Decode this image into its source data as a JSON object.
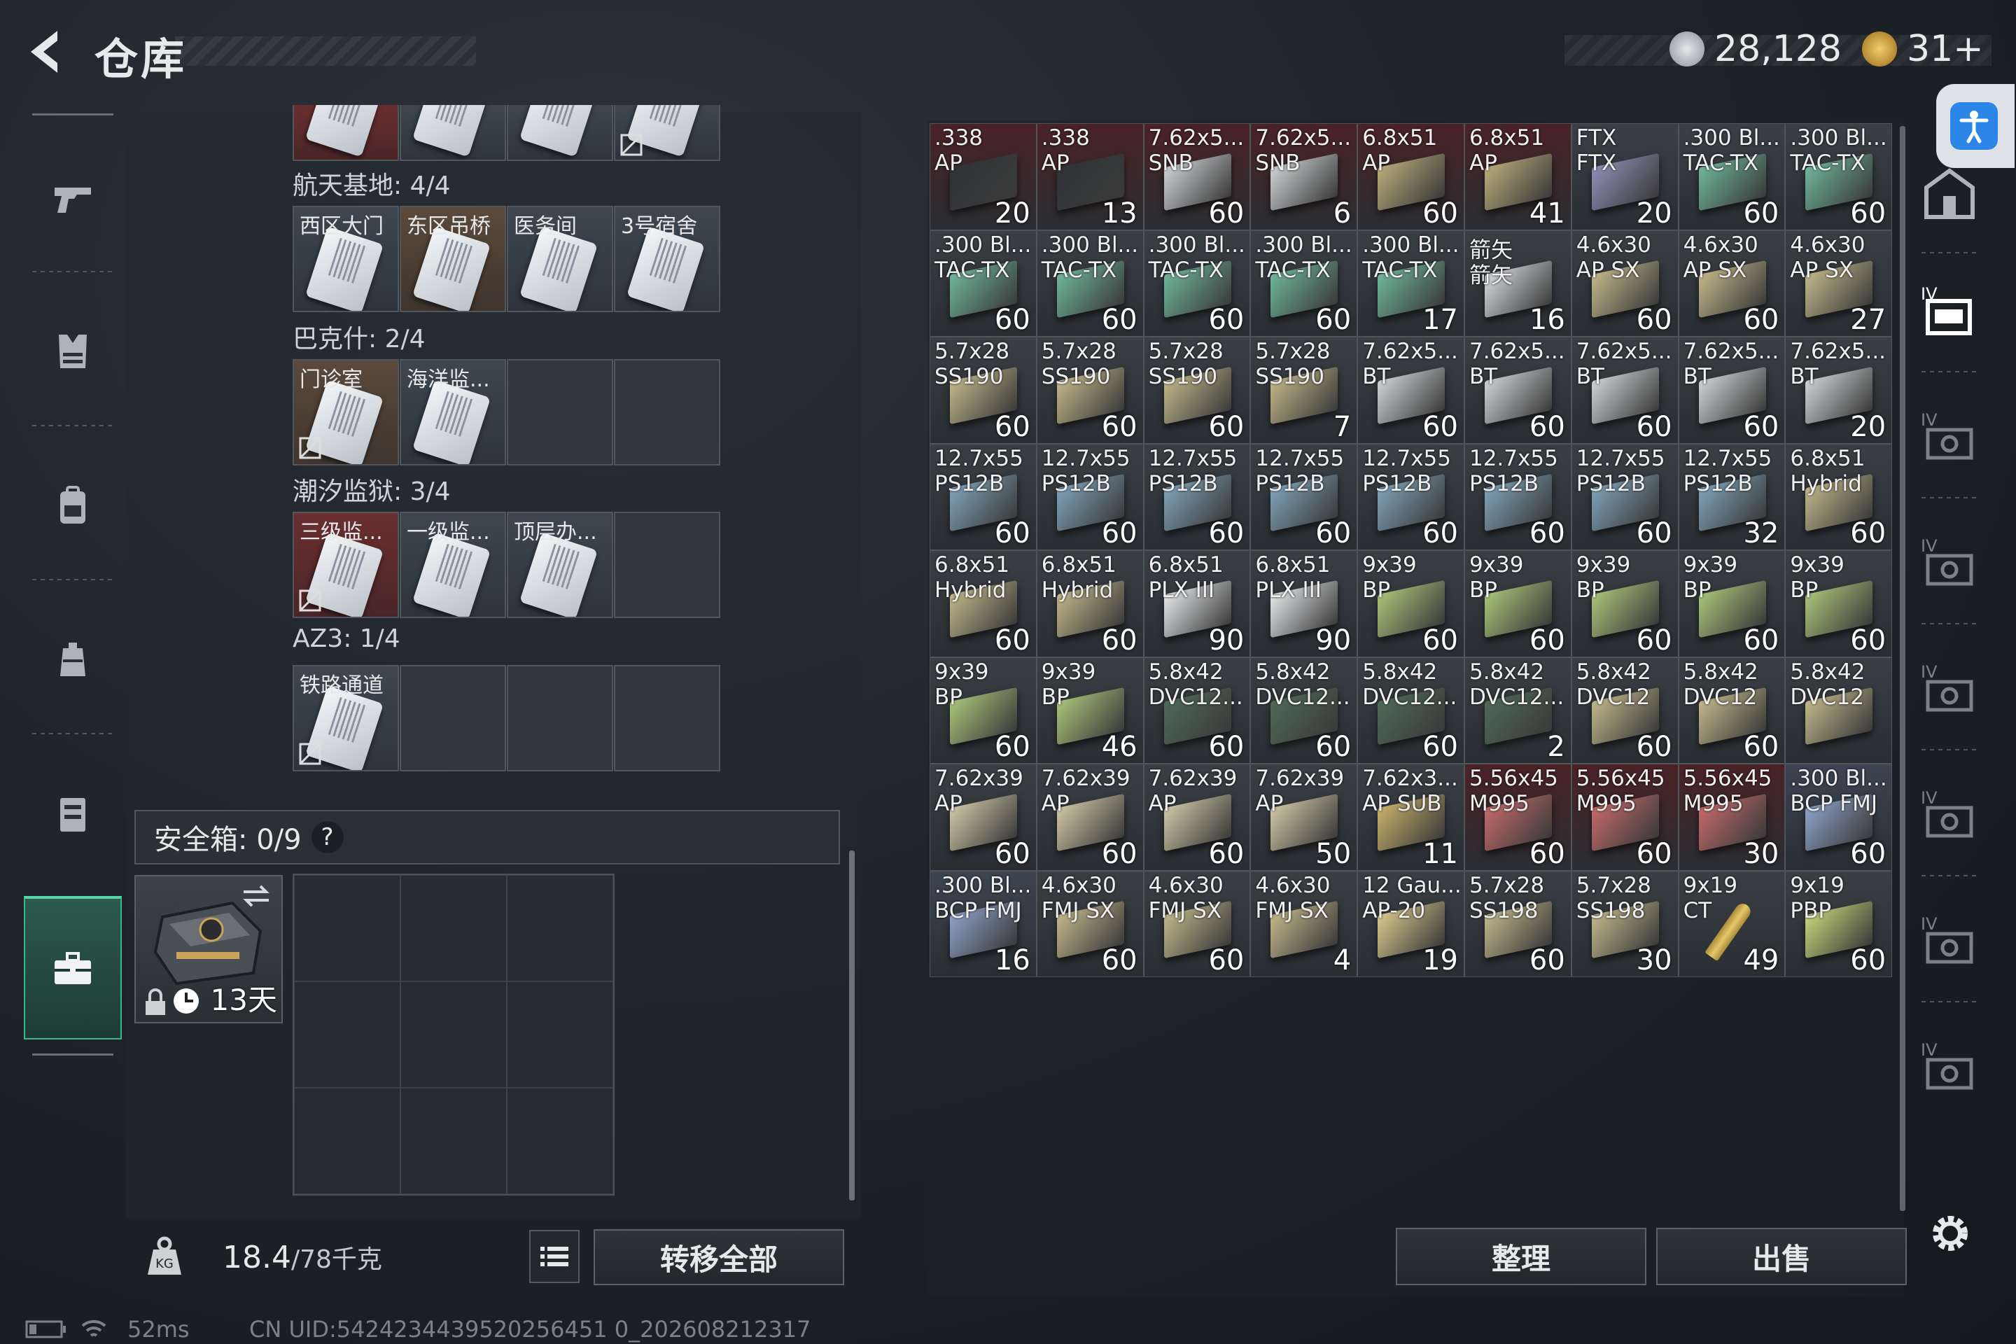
{
  "header": {
    "title": "仓库",
    "currency1": "28,128",
    "currency2": "31+",
    "colors": {
      "silver": "#c8ccd0",
      "gold": "#d9a93c"
    }
  },
  "nav": {
    "items": [
      "pistol-icon",
      "vest-icon",
      "backpack-icon",
      "rig-icon",
      "container-icon",
      "case-icon"
    ],
    "active_index": 5
  },
  "keycards": {
    "groups": [
      {
        "label": "航天基地: 4/4",
        "slots": [
          {
            "name": "西区大门",
            "color": "slate"
          },
          {
            "name": "东区吊桥",
            "color": "brown"
          },
          {
            "name": "医务间",
            "color": "slate"
          },
          {
            "name": "3号宿舍",
            "color": "slate"
          }
        ]
      },
      {
        "label": "巴克什: 2/4",
        "slots": [
          {
            "name": "门诊室",
            "color": "brown",
            "locked": true
          },
          {
            "name": "海洋监...",
            "color": "slate"
          },
          {
            "name": "",
            "color": ""
          },
          {
            "name": "",
            "color": ""
          }
        ]
      },
      {
        "label": "潮汐监狱: 3/4",
        "slots": [
          {
            "name": "三级监...",
            "color": "red",
            "locked": true
          },
          {
            "name": "一级监...",
            "color": "slate"
          },
          {
            "name": "顶层办...",
            "color": "slate"
          },
          {
            "name": "",
            "color": ""
          }
        ]
      },
      {
        "label": "AZ3: 1/4",
        "slots": [
          {
            "name": "铁路通道",
            "color": "slate",
            "locked": true
          },
          {
            "name": "",
            "color": ""
          },
          {
            "name": "",
            "color": ""
          },
          {
            "name": "",
            "color": ""
          }
        ]
      }
    ]
  },
  "safe": {
    "label": "安全箱: 0/9",
    "help": "?",
    "days": "13天"
  },
  "footer_left": {
    "weight": "18.4",
    "weight_max": "/78千克",
    "transfer_all": "转移全部"
  },
  "footer_right": {
    "sort": "整理",
    "sell": "出售"
  },
  "status": {
    "ping": "52ms",
    "uid": "CN UID:5424234439520256451 0_202608212317"
  },
  "ammo": [
    {
      "a": ".338",
      "b": "AP",
      "q": "20",
      "bg": "#4a2226",
      "box": "#2f3336"
    },
    {
      "a": ".338",
      "b": "AP",
      "q": "13",
      "bg": "#4a2226",
      "box": "#2f3336"
    },
    {
      "a": "7.62x5...",
      "b": "SNB",
      "q": "60",
      "bg": "#4a2226",
      "box": "#cfd2d4"
    },
    {
      "a": "7.62x5...",
      "b": "SNB",
      "q": "6",
      "bg": "#4a2226",
      "box": "#cfd2d4"
    },
    {
      "a": "6.8x51",
      "b": "AP",
      "q": "60",
      "bg": "#4a2226",
      "box": "#b9ab7a"
    },
    {
      "a": "6.8x51",
      "b": "AP",
      "q": "41",
      "bg": "#4a2226",
      "box": "#b9ab7a"
    },
    {
      "a": "FTX",
      "b": "FTX",
      "q": "20",
      "bg": "#3b4046",
      "box": "#8f8fb8"
    },
    {
      "a": ".300 Bl...",
      "b": "TAC-TX",
      "q": "60",
      "bg": "#3b4046",
      "box": "#6fb59b"
    },
    {
      "a": ".300 Bl...",
      "b": "TAC-TX",
      "q": "60",
      "bg": "#3b4046",
      "box": "#6fb59b"
    },
    {
      "a": ".300 Bl...",
      "b": "TAC-TX",
      "q": "60",
      "bg": "#3a3f44",
      "box": "#6fb59b"
    },
    {
      "a": ".300 Bl...",
      "b": "TAC-TX",
      "q": "60",
      "bg": "#3a3f44",
      "box": "#6fb59b"
    },
    {
      "a": ".300 Bl...",
      "b": "TAC-TX",
      "q": "60",
      "bg": "#3a3f44",
      "box": "#6fb59b"
    },
    {
      "a": ".300 Bl...",
      "b": "TAC-TX",
      "q": "60",
      "bg": "#3a3f44",
      "box": "#6fb59b"
    },
    {
      "a": ".300 Bl...",
      "b": "TAC-TX",
      "q": "17",
      "bg": "#3a3f44",
      "box": "#6fb59b"
    },
    {
      "a": "箭矢",
      "b": "箭矢",
      "q": "16",
      "bg": "#3a3f44",
      "box": "#d9dcdf"
    },
    {
      "a": "4.6x30",
      "b": "AP SX",
      "q": "60",
      "bg": "#3a3f44",
      "box": "#c2b78a"
    },
    {
      "a": "4.6x30",
      "b": "AP SX",
      "q": "60",
      "bg": "#3a3f44",
      "box": "#c2b78a"
    },
    {
      "a": "4.6x30",
      "b": "AP SX",
      "q": "27",
      "bg": "#3a3f44",
      "box": "#c2b78a"
    },
    {
      "a": "5.7x28",
      "b": "SS190",
      "q": "60",
      "bg": "#3a3f44",
      "box": "#c2b78a"
    },
    {
      "a": "5.7x28",
      "b": "SS190",
      "q": "60",
      "bg": "#3a3f44",
      "box": "#c2b78a"
    },
    {
      "a": "5.7x28",
      "b": "SS190",
      "q": "60",
      "bg": "#3a3f44",
      "box": "#c2b78a"
    },
    {
      "a": "5.7x28",
      "b": "SS190",
      "q": "7",
      "bg": "#3a3f44",
      "box": "#c2b78a"
    },
    {
      "a": "7.62x5...",
      "b": "BT",
      "q": "60",
      "bg": "#3a3f44",
      "box": "#cfd2d4"
    },
    {
      "a": "7.62x5...",
      "b": "BT",
      "q": "60",
      "bg": "#3a3f44",
      "box": "#cfd2d4"
    },
    {
      "a": "7.62x5...",
      "b": "BT",
      "q": "60",
      "bg": "#3a3f44",
      "box": "#cfd2d4"
    },
    {
      "a": "7.62x5...",
      "b": "BT",
      "q": "60",
      "bg": "#3a3f44",
      "box": "#cfd2d4"
    },
    {
      "a": "7.62x5...",
      "b": "BT",
      "q": "20",
      "bg": "#3a3f44",
      "box": "#cfd2d4"
    },
    {
      "a": "12.7x55",
      "b": "PS12B",
      "q": "60",
      "bg": "#3a3f44",
      "box": "#7fa3b9"
    },
    {
      "a": "12.7x55",
      "b": "PS12B",
      "q": "60",
      "bg": "#3a3f44",
      "box": "#7fa3b9"
    },
    {
      "a": "12.7x55",
      "b": "PS12B",
      "q": "60",
      "bg": "#3a3f44",
      "box": "#7fa3b9"
    },
    {
      "a": "12.7x55",
      "b": "PS12B",
      "q": "60",
      "bg": "#3a3f44",
      "box": "#7fa3b9"
    },
    {
      "a": "12.7x55",
      "b": "PS12B",
      "q": "60",
      "bg": "#3a3f44",
      "box": "#7fa3b9"
    },
    {
      "a": "12.7x55",
      "b": "PS12B",
      "q": "60",
      "bg": "#3a3f44",
      "box": "#7fa3b9"
    },
    {
      "a": "12.7x55",
      "b": "PS12B",
      "q": "60",
      "bg": "#3a3f44",
      "box": "#7fa3b9"
    },
    {
      "a": "12.7x55",
      "b": "PS12B",
      "q": "32",
      "bg": "#3a3f44",
      "box": "#7fa3b9"
    },
    {
      "a": "6.8x51",
      "b": "Hybrid",
      "q": "60",
      "bg": "#3a3f44",
      "box": "#c2b78a"
    },
    {
      "a": "6.8x51",
      "b": "Hybrid",
      "q": "60",
      "bg": "#3a3f44",
      "box": "#c2b78a"
    },
    {
      "a": "6.8x51",
      "b": "Hybrid",
      "q": "60",
      "bg": "#3a3f44",
      "box": "#c2b78a"
    },
    {
      "a": "6.8x51",
      "b": "PLX III",
      "q": "90",
      "bg": "#3a3f44",
      "box": "#e6e8ea"
    },
    {
      "a": "6.8x51",
      "b": "PLX III",
      "q": "90",
      "bg": "#3a3f44",
      "box": "#e6e8ea"
    },
    {
      "a": "9x39",
      "b": "BP",
      "q": "60",
      "bg": "#3a3f44",
      "box": "#a9c47a"
    },
    {
      "a": "9x39",
      "b": "BP",
      "q": "60",
      "bg": "#3a3f44",
      "box": "#a9c47a"
    },
    {
      "a": "9x39",
      "b": "BP",
      "q": "60",
      "bg": "#3a3f44",
      "box": "#a9c47a"
    },
    {
      "a": "9x39",
      "b": "BP",
      "q": "60",
      "bg": "#3a3f44",
      "box": "#a9c47a"
    },
    {
      "a": "9x39",
      "b": "BP",
      "q": "60",
      "bg": "#3a3f44",
      "box": "#a9c47a"
    },
    {
      "a": "9x39",
      "b": "BP",
      "q": "60",
      "bg": "#3a3f44",
      "box": "#a9c47a"
    },
    {
      "a": "9x39",
      "b": "BP",
      "q": "46",
      "bg": "#3a3f44",
      "box": "#a9c47a"
    },
    {
      "a": "5.8x42",
      "b": "DVC12...",
      "q": "60",
      "bg": "#3a3f44",
      "box": "#4e6a56"
    },
    {
      "a": "5.8x42",
      "b": "DVC12...",
      "q": "60",
      "bg": "#3a3f44",
      "box": "#4e6a56"
    },
    {
      "a": "5.8x42",
      "b": "DVC12...",
      "q": "60",
      "bg": "#3a3f44",
      "box": "#4e6a56"
    },
    {
      "a": "5.8x42",
      "b": "DVC12...",
      "q": "2",
      "bg": "#3a3f44",
      "box": "#4e6a56"
    },
    {
      "a": "5.8x42",
      "b": "DVC12",
      "q": "60",
      "bg": "#3a3f44",
      "box": "#c2b78a"
    },
    {
      "a": "5.8x42",
      "b": "DVC12",
      "q": "60",
      "bg": "#3a3f44",
      "box": "#c2b78a"
    },
    {
      "a": "5.8x42",
      "b": "DVC12",
      "q": "",
      "bg": "#3a3f44",
      "box": "#c2b78a"
    },
    {
      "a": "7.62x39",
      "b": "AP",
      "q": "60",
      "bg": "#3a3f44",
      "box": "#d0c7a5"
    },
    {
      "a": "7.62x39",
      "b": "AP",
      "q": "60",
      "bg": "#3a3f44",
      "box": "#d0c7a5"
    },
    {
      "a": "7.62x39",
      "b": "AP",
      "q": "60",
      "bg": "#3a3f44",
      "box": "#d0c7a5"
    },
    {
      "a": "7.62x39",
      "b": "AP",
      "q": "50",
      "bg": "#3a3f44",
      "box": "#d0c7a5"
    },
    {
      "a": "7.62x3...",
      "b": "AP SUB",
      "q": "11",
      "bg": "#3a3f44",
      "box": "#c9b16a"
    },
    {
      "a": "5.56x45",
      "b": "M995",
      "q": "60",
      "bg": "#4a2226",
      "box": "#c46a6a"
    },
    {
      "a": "5.56x45",
      "b": "M995",
      "q": "60",
      "bg": "#4a2226",
      "box": "#c46a6a"
    },
    {
      "a": "5.56x45",
      "b": "M995",
      "q": "30",
      "bg": "#4a2226",
      "box": "#c46a6a"
    },
    {
      "a": ".300 Bl...",
      "b": "BCP FMJ",
      "q": "60",
      "bg": "#3d4552",
      "box": "#8ea2c9"
    },
    {
      "a": ".300 Bl...",
      "b": "BCP FMJ",
      "q": "16",
      "bg": "#3d4552",
      "box": "#8ea2c9"
    },
    {
      "a": "4.6x30",
      "b": "FMJ SX",
      "q": "60",
      "bg": "#3a3f44",
      "box": "#c2b78a"
    },
    {
      "a": "4.6x30",
      "b": "FMJ SX",
      "q": "60",
      "bg": "#3a3f44",
      "box": "#c2b78a"
    },
    {
      "a": "4.6x30",
      "b": "FMJ SX",
      "q": "4",
      "bg": "#3a3f44",
      "box": "#c2b78a"
    },
    {
      "a": "12 Gau...",
      "b": "AP-20",
      "q": "19",
      "bg": "#3a3f44",
      "box": "#d9c98e"
    },
    {
      "a": "5.7x28",
      "b": "SS198",
      "q": "60",
      "bg": "#3a3f44",
      "box": "#c2b78a"
    },
    {
      "a": "5.7x28",
      "b": "SS198",
      "q": "30",
      "bg": "#3a3f44",
      "box": "#c2b78a"
    },
    {
      "a": "9x19",
      "b": "CT",
      "q": "49",
      "bg": "#3a3f44",
      "box": "bullet"
    },
    {
      "a": "9x19",
      "b": "PBP",
      "q": "60",
      "bg": "#3a3f44",
      "box": "#c6d67a"
    }
  ]
}
